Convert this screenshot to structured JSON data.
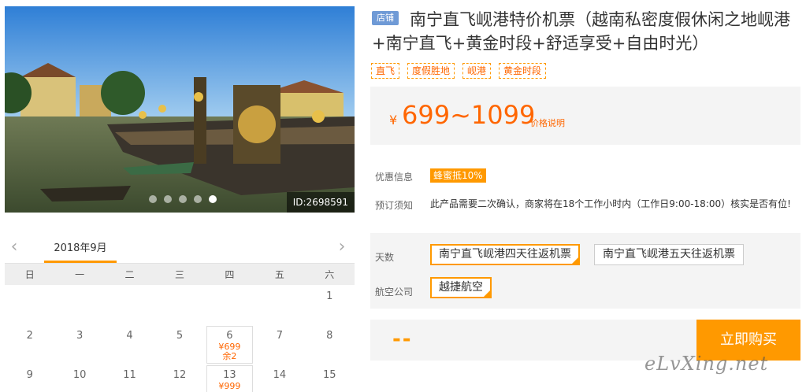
{
  "gallery": {
    "image_id": "ID:2698591",
    "slide_count": 5,
    "active_slide": 5
  },
  "calendar": {
    "month_label": "2018年9月",
    "weekdays": [
      "日",
      "一",
      "二",
      "三",
      "四",
      "五",
      "六"
    ],
    "rows": [
      [
        {
          "day": ""
        },
        {
          "day": ""
        },
        {
          "day": ""
        },
        {
          "day": ""
        },
        {
          "day": ""
        },
        {
          "day": ""
        },
        {
          "day": "1"
        }
      ],
      [
        {
          "day": "2"
        },
        {
          "day": "3"
        },
        {
          "day": "4"
        },
        {
          "day": "5"
        },
        {
          "day": "6",
          "price": "¥699",
          "stock": "余2"
        },
        {
          "day": "7"
        },
        {
          "day": "8"
        }
      ],
      [
        {
          "day": "9"
        },
        {
          "day": "10"
        },
        {
          "day": "11"
        },
        {
          "day": "12"
        },
        {
          "day": "13",
          "price": "¥999"
        },
        {
          "day": "14"
        },
        {
          "day": "15"
        }
      ]
    ]
  },
  "product": {
    "shop_badge": "店铺",
    "title": "南宁直飞岘港特价机票（越南私密度假休闲之地岘港+南宁直飞+黄金时段+舒适享受+自由时光）",
    "tags": [
      "直飞",
      "度假胜地",
      "岘港",
      "黄金时段"
    ],
    "price_currency": "¥",
    "price_range": "699~1099",
    "price_note": "价格说明",
    "promo_label": "优惠信息",
    "promo_badge": "蜂蜜抵10%",
    "notice_label": "预订须知",
    "notice_text": "此产品需要二次确认，商家将在18个工作小时内（工作日9:00-18:00）核实是否有位!",
    "days_label": "天数",
    "day_options": [
      "南宁直飞岘港四天往返机票",
      "南宁直飞岘港五天往返机票"
    ],
    "airline_label": "航空公司",
    "airline_options": [
      "越捷航空"
    ],
    "total_placeholder": "--",
    "buy_label": "立即购买"
  },
  "watermark": "eLvXing.net",
  "colors": {
    "accent": "#ff9900",
    "price": "#ff6600",
    "badge": "#6f9ad6"
  }
}
